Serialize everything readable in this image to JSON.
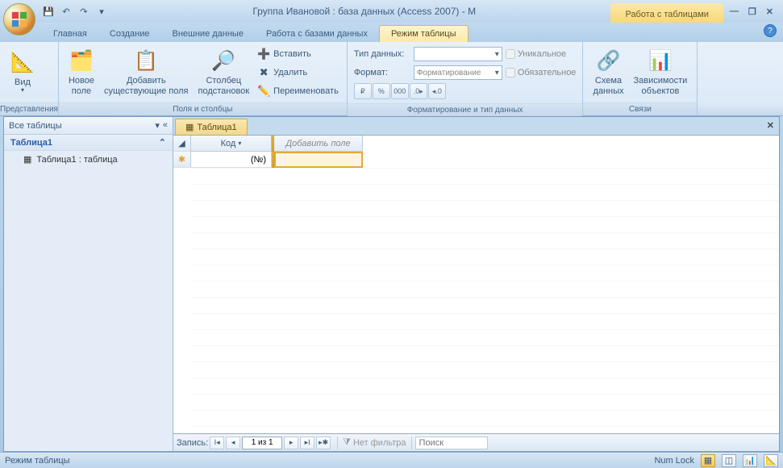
{
  "title": "Группа Ивановой : база данных (Access 2007) - M",
  "context_tab_group": "Работа с таблицами",
  "tabs": {
    "home": "Главная",
    "create": "Создание",
    "external": "Внешние данные",
    "dbtools": "Работа с базами данных",
    "datasheet": "Режим таблицы"
  },
  "ribbon": {
    "views": {
      "btn": "Вид",
      "label": "Представления"
    },
    "fields": {
      "new_field": "Новое\nполе",
      "add_existing": "Добавить\nсуществующие поля",
      "lookup": "Столбец\nподстановок",
      "insert": "Вставить",
      "delete": "Удалить",
      "rename": "Переименовать",
      "label": "Поля и столбцы"
    },
    "fmt": {
      "datatype_label": "Тип данных:",
      "format_label": "Формат:",
      "format_placeholder": "Форматирование",
      "unique": "Уникальное",
      "required": "Обязательное",
      "currency": "₽",
      "percent": "%",
      "thousands": "000",
      "inc": ".0▸",
      "dec": "◂.0",
      "label": "Форматирование и тип данных"
    },
    "rel": {
      "schema": "Схема\nданных",
      "deps": "Зависимости\nобъектов",
      "label": "Связи"
    }
  },
  "nav": {
    "header": "Все таблицы",
    "group": "Таблица1",
    "item": "Таблица1 : таблица"
  },
  "doc": {
    "tab": "Таблица1",
    "col_id": "Код",
    "col_add": "Добавить поле",
    "row_val": "(№)"
  },
  "recnav": {
    "label": "Запись:",
    "pos": "1 из 1",
    "nofilter": "Нет фильтра",
    "search": "Поиск"
  },
  "status": {
    "mode": "Режим таблицы",
    "numlock": "Num Lock"
  }
}
